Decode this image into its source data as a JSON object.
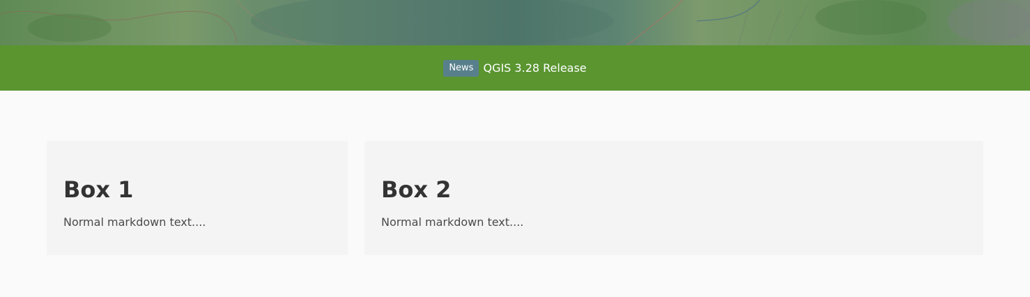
{
  "news": {
    "badge": "News",
    "title": "QGIS 3.28 Release"
  },
  "boxes": [
    {
      "heading": "Box 1",
      "text": "Normal markdown text...."
    },
    {
      "heading": "Box 2",
      "text": "Normal markdown text...."
    }
  ],
  "colors": {
    "news_bar": "#5a9530",
    "badge": "#587f8c",
    "page_bg": "#fafafa",
    "box_bg": "#f4f4f4"
  }
}
